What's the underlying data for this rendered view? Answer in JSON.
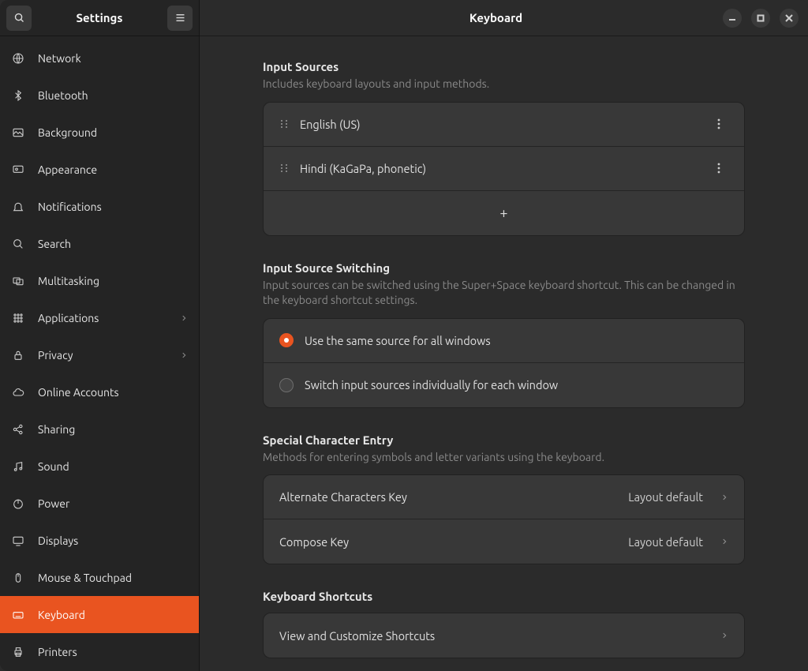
{
  "header": {
    "settings_title": "Settings",
    "page_title": "Keyboard"
  },
  "sidebar": {
    "items": [
      {
        "label": "Network"
      },
      {
        "label": "Bluetooth"
      },
      {
        "label": "Background"
      },
      {
        "label": "Appearance"
      },
      {
        "label": "Notifications"
      },
      {
        "label": "Search"
      },
      {
        "label": "Multitasking"
      },
      {
        "label": "Applications",
        "chev": true
      },
      {
        "label": "Privacy",
        "chev": true
      },
      {
        "label": "Online Accounts"
      },
      {
        "label": "Sharing"
      },
      {
        "label": "Sound"
      },
      {
        "label": "Power"
      },
      {
        "label": "Displays"
      },
      {
        "label": "Mouse & Touchpad"
      },
      {
        "label": "Keyboard"
      },
      {
        "label": "Printers"
      }
    ]
  },
  "input_sources": {
    "title": "Input Sources",
    "desc": "Includes keyboard layouts and input methods.",
    "items": [
      "English (US)",
      "Hindi (KaGaPa, phonetic)"
    ]
  },
  "switching": {
    "title": "Input Source Switching",
    "desc": "Input sources can be switched using the Super+Space keyboard shortcut. This can be changed in the keyboard shortcut settings.",
    "opt_same": "Use the same source for all windows",
    "opt_each": "Switch input sources individually for each window"
  },
  "special": {
    "title": "Special Character Entry",
    "desc": "Methods for entering symbols and letter variants using the keyboard.",
    "alt_key": "Alternate Characters Key",
    "alt_val": "Layout default",
    "compose_key": "Compose Key",
    "compose_val": "Layout default"
  },
  "shortcuts": {
    "title": "Keyboard Shortcuts",
    "view": "View and Customize Shortcuts"
  }
}
